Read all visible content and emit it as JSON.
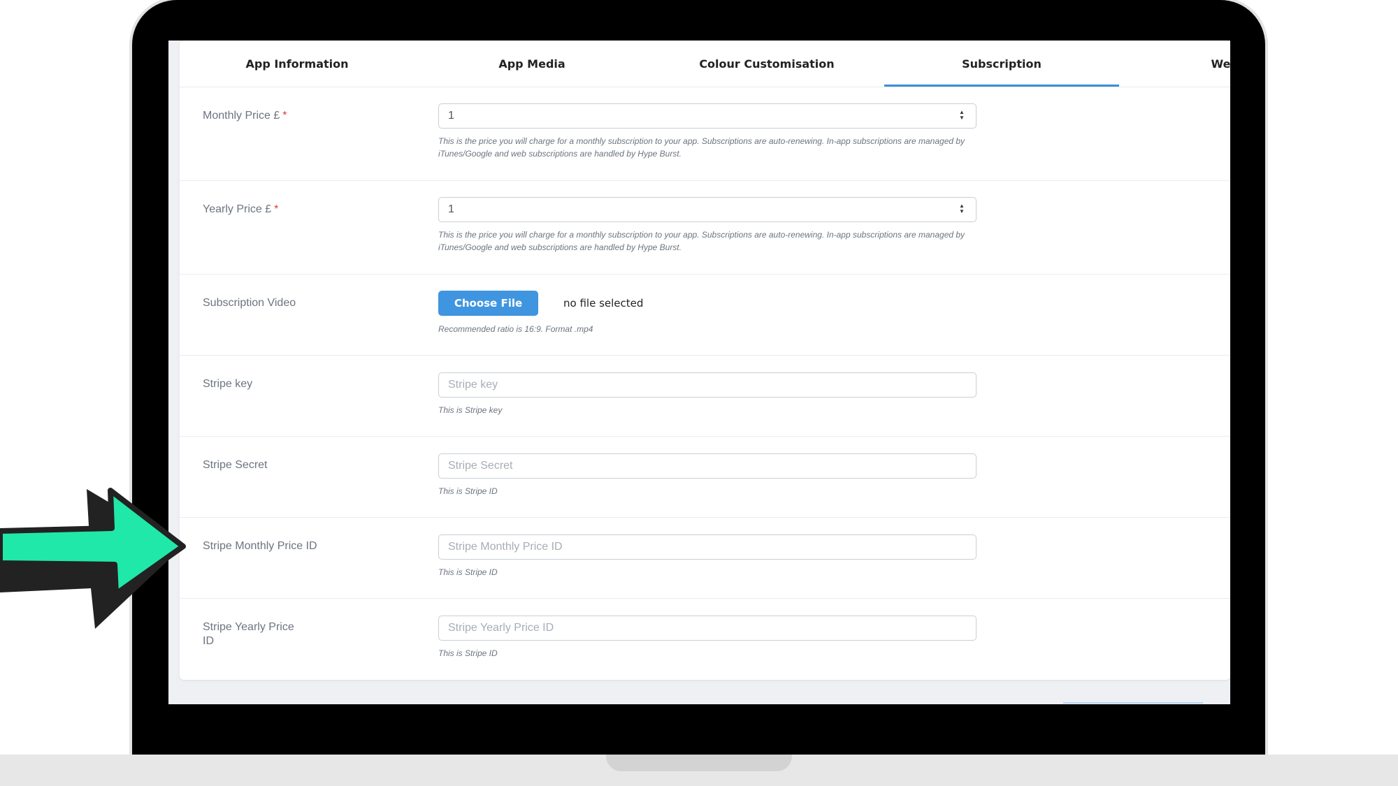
{
  "tabs": [
    {
      "label": "App Information"
    },
    {
      "label": "App Media"
    },
    {
      "label": "Colour Customisation"
    },
    {
      "label": "Subscription"
    },
    {
      "label": "Website"
    }
  ],
  "active_tab": "Subscription",
  "form": {
    "monthly_price": {
      "label": "Monthly Price £",
      "required_mark": "*",
      "value": "1",
      "help": "This is the price you will charge for a monthly subscription to your app. Subscriptions are auto-renewing. In-app subscriptions are managed by iTunes/Google and web subscriptions are handled by Hype Burst."
    },
    "yearly_price": {
      "label": "Yearly Price £",
      "required_mark": "*",
      "value": "1",
      "help": "This is the price you will charge for a monthly subscription to your app. Subscriptions are auto-renewing. In-app subscriptions are managed by iTunes/Google and web subscriptions are handled by Hype Burst."
    },
    "subscription_video": {
      "label": "Subscription Video",
      "button_label": "Choose File",
      "file_status": "no file selected",
      "help": "Recommended ratio is 16:9. Format .mp4"
    },
    "stripe_key": {
      "label": "Stripe key",
      "placeholder": "Stripe key",
      "help": "This is Stripe key"
    },
    "stripe_secret": {
      "label": "Stripe Secret",
      "placeholder": "Stripe Secret",
      "help": "This is Stripe ID"
    },
    "stripe_monthly_price_id": {
      "label": "Stripe Monthly Price ID",
      "placeholder": "Stripe Monthly Price ID",
      "help": "This is Stripe ID"
    },
    "stripe_yearly_price_id": {
      "label": "Stripe Yearly Price ID",
      "placeholder": "Stripe Yearly Price ID",
      "help": "This is Stripe ID"
    }
  },
  "colors": {
    "accent": "#3f95df",
    "arrow_fill": "#20e8a8",
    "arrow_outline": "#222222",
    "required": "#e03b3b"
  },
  "icons": {
    "number_spinner": "spinner-arrows-icon",
    "pointer_arrow": "pointing-arrow-icon"
  }
}
